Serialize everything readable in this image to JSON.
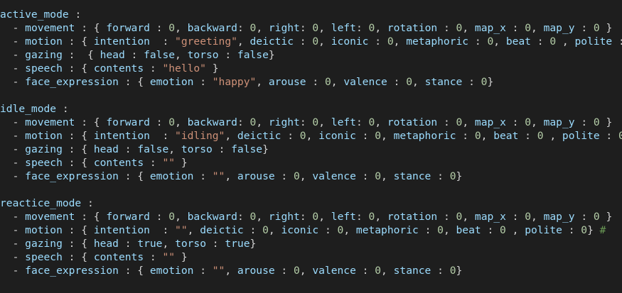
{
  "colors": {
    "background": "#1e1e1e",
    "key": "#9cdcfe",
    "punctuation": "#d4d4d4",
    "number": "#b5cea8",
    "string": "#ce9178",
    "comment": "#6a9955"
  },
  "lines": [
    [
      [
        "k",
        "active_mode"
      ],
      [
        "p",
        " :"
      ]
    ],
    [
      [
        "d",
        "  - "
      ],
      [
        "k",
        "movement"
      ],
      [
        "p",
        " : { "
      ],
      [
        "k",
        "forward"
      ],
      [
        "p",
        " : "
      ],
      [
        "n",
        "0"
      ],
      [
        "p",
        ", "
      ],
      [
        "k",
        "backward"
      ],
      [
        "p",
        ": "
      ],
      [
        "n",
        "0"
      ],
      [
        "p",
        ", "
      ],
      [
        "k",
        "right"
      ],
      [
        "p",
        ": "
      ],
      [
        "n",
        "0"
      ],
      [
        "p",
        ", "
      ],
      [
        "k",
        "left"
      ],
      [
        "p",
        ": "
      ],
      [
        "n",
        "0"
      ],
      [
        "p",
        ", "
      ],
      [
        "k",
        "rotation"
      ],
      [
        "p",
        " : "
      ],
      [
        "n",
        "0"
      ],
      [
        "p",
        ", "
      ],
      [
        "k",
        "map_x"
      ],
      [
        "p",
        " : "
      ],
      [
        "n",
        "0"
      ],
      [
        "p",
        ", "
      ],
      [
        "k",
        "map_y"
      ],
      [
        "p",
        " : "
      ],
      [
        "n",
        "0"
      ],
      [
        "p",
        " }"
      ]
    ],
    [
      [
        "d",
        "  - "
      ],
      [
        "k",
        "motion"
      ],
      [
        "p",
        " : { "
      ],
      [
        "k",
        "intention"
      ],
      [
        "p",
        "  : "
      ],
      [
        "s",
        "\"greeting\""
      ],
      [
        "p",
        ", "
      ],
      [
        "k",
        "deictic"
      ],
      [
        "p",
        " : "
      ],
      [
        "n",
        "0"
      ],
      [
        "p",
        ", "
      ],
      [
        "k",
        "iconic"
      ],
      [
        "p",
        " : "
      ],
      [
        "n",
        "0"
      ],
      [
        "p",
        ", "
      ],
      [
        "k",
        "metaphoric"
      ],
      [
        "p",
        " : "
      ],
      [
        "n",
        "0"
      ],
      [
        "p",
        ", "
      ],
      [
        "k",
        "beat"
      ],
      [
        "p",
        " : "
      ],
      [
        "n",
        "0"
      ],
      [
        "p",
        " , "
      ],
      [
        "k",
        "polite"
      ],
      [
        "p",
        " : "
      ],
      [
        "n",
        "0"
      ],
      [
        "p",
        "} "
      ],
      [
        "c",
        "#"
      ]
    ],
    [
      [
        "d",
        "  - "
      ],
      [
        "k",
        "gazing"
      ],
      [
        "p",
        " :  { "
      ],
      [
        "k",
        "head"
      ],
      [
        "p",
        " : "
      ],
      [
        "k",
        "false"
      ],
      [
        "p",
        ", "
      ],
      [
        "k",
        "torso"
      ],
      [
        "p",
        " : "
      ],
      [
        "k",
        "false"
      ],
      [
        "p",
        "}"
      ]
    ],
    [
      [
        "d",
        "  - "
      ],
      [
        "k",
        "speech"
      ],
      [
        "p",
        " : { "
      ],
      [
        "k",
        "contents"
      ],
      [
        "p",
        " : "
      ],
      [
        "s",
        "\"hello\""
      ],
      [
        "p",
        " }"
      ]
    ],
    [
      [
        "d",
        "  - "
      ],
      [
        "k",
        "face_expression"
      ],
      [
        "p",
        " : { "
      ],
      [
        "k",
        "emotion"
      ],
      [
        "p",
        " : "
      ],
      [
        "s",
        "\"happy\""
      ],
      [
        "p",
        ", "
      ],
      [
        "k",
        "arouse"
      ],
      [
        "p",
        " : "
      ],
      [
        "n",
        "0"
      ],
      [
        "p",
        ", "
      ],
      [
        "k",
        "valence"
      ],
      [
        "p",
        " : "
      ],
      [
        "n",
        "0"
      ],
      [
        "p",
        ", "
      ],
      [
        "k",
        "stance"
      ],
      [
        "p",
        " : "
      ],
      [
        "n",
        "0"
      ],
      [
        "p",
        "}"
      ]
    ],
    [],
    [
      [
        "k",
        "idle_mode"
      ],
      [
        "p",
        " :"
      ]
    ],
    [
      [
        "d",
        "  - "
      ],
      [
        "k",
        "movement"
      ],
      [
        "p",
        " : { "
      ],
      [
        "k",
        "forward"
      ],
      [
        "p",
        " : "
      ],
      [
        "n",
        "0"
      ],
      [
        "p",
        ", "
      ],
      [
        "k",
        "backward"
      ],
      [
        "p",
        ": "
      ],
      [
        "n",
        "0"
      ],
      [
        "p",
        ", "
      ],
      [
        "k",
        "right"
      ],
      [
        "p",
        ": "
      ],
      [
        "n",
        "0"
      ],
      [
        "p",
        ", "
      ],
      [
        "k",
        "left"
      ],
      [
        "p",
        ": "
      ],
      [
        "n",
        "0"
      ],
      [
        "p",
        ", "
      ],
      [
        "k",
        "rotation"
      ],
      [
        "p",
        " : "
      ],
      [
        "n",
        "0"
      ],
      [
        "p",
        ", "
      ],
      [
        "k",
        "map_x"
      ],
      [
        "p",
        " : "
      ],
      [
        "n",
        "0"
      ],
      [
        "p",
        ", "
      ],
      [
        "k",
        "map_y"
      ],
      [
        "p",
        " : "
      ],
      [
        "n",
        "0"
      ],
      [
        "p",
        " }"
      ]
    ],
    [
      [
        "d",
        "  - "
      ],
      [
        "k",
        "motion"
      ],
      [
        "p",
        " : { "
      ],
      [
        "k",
        "intention"
      ],
      [
        "p",
        "  : "
      ],
      [
        "s",
        "\"idling\""
      ],
      [
        "p",
        ", "
      ],
      [
        "k",
        "deictic"
      ],
      [
        "p",
        " : "
      ],
      [
        "n",
        "0"
      ],
      [
        "p",
        ", "
      ],
      [
        "k",
        "iconic"
      ],
      [
        "p",
        " : "
      ],
      [
        "n",
        "0"
      ],
      [
        "p",
        ", "
      ],
      [
        "k",
        "metaphoric"
      ],
      [
        "p",
        " : "
      ],
      [
        "n",
        "0"
      ],
      [
        "p",
        ", "
      ],
      [
        "k",
        "beat"
      ],
      [
        "p",
        " : "
      ],
      [
        "n",
        "0"
      ],
      [
        "p",
        " , "
      ],
      [
        "k",
        "polite"
      ],
      [
        "p",
        " : "
      ],
      [
        "n",
        "0"
      ],
      [
        "p",
        "}"
      ]
    ],
    [
      [
        "d",
        "  - "
      ],
      [
        "k",
        "gazing"
      ],
      [
        "p",
        " : { "
      ],
      [
        "k",
        "head"
      ],
      [
        "p",
        " : "
      ],
      [
        "k",
        "false"
      ],
      [
        "p",
        ", "
      ],
      [
        "k",
        "torso"
      ],
      [
        "p",
        " : "
      ],
      [
        "k",
        "false"
      ],
      [
        "p",
        "}"
      ]
    ],
    [
      [
        "d",
        "  - "
      ],
      [
        "k",
        "speech"
      ],
      [
        "p",
        " : { "
      ],
      [
        "k",
        "contents"
      ],
      [
        "p",
        " : "
      ],
      [
        "s",
        "\"\""
      ],
      [
        "p",
        " }"
      ]
    ],
    [
      [
        "d",
        "  - "
      ],
      [
        "k",
        "face_expression"
      ],
      [
        "p",
        " : { "
      ],
      [
        "k",
        "emotion"
      ],
      [
        "p",
        " : "
      ],
      [
        "s",
        "\"\""
      ],
      [
        "p",
        ", "
      ],
      [
        "k",
        "arouse"
      ],
      [
        "p",
        " : "
      ],
      [
        "n",
        "0"
      ],
      [
        "p",
        ", "
      ],
      [
        "k",
        "valence"
      ],
      [
        "p",
        " : "
      ],
      [
        "n",
        "0"
      ],
      [
        "p",
        ", "
      ],
      [
        "k",
        "stance"
      ],
      [
        "p",
        " : "
      ],
      [
        "n",
        "0"
      ],
      [
        "p",
        "}"
      ]
    ],
    [],
    [
      [
        "k",
        "reactice_mode"
      ],
      [
        "p",
        " :"
      ]
    ],
    [
      [
        "d",
        "  - "
      ],
      [
        "k",
        "movement"
      ],
      [
        "p",
        " : { "
      ],
      [
        "k",
        "forward"
      ],
      [
        "p",
        " : "
      ],
      [
        "n",
        "0"
      ],
      [
        "p",
        ", "
      ],
      [
        "k",
        "backward"
      ],
      [
        "p",
        ": "
      ],
      [
        "n",
        "0"
      ],
      [
        "p",
        ", "
      ],
      [
        "k",
        "right"
      ],
      [
        "p",
        ": "
      ],
      [
        "n",
        "0"
      ],
      [
        "p",
        ", "
      ],
      [
        "k",
        "left"
      ],
      [
        "p",
        ": "
      ],
      [
        "n",
        "0"
      ],
      [
        "p",
        ", "
      ],
      [
        "k",
        "rotation"
      ],
      [
        "p",
        " : "
      ],
      [
        "n",
        "0"
      ],
      [
        "p",
        ", "
      ],
      [
        "k",
        "map_x"
      ],
      [
        "p",
        " : "
      ],
      [
        "n",
        "0"
      ],
      [
        "p",
        ", "
      ],
      [
        "k",
        "map_y"
      ],
      [
        "p",
        " : "
      ],
      [
        "n",
        "0"
      ],
      [
        "p",
        " }"
      ]
    ],
    [
      [
        "d",
        "  - "
      ],
      [
        "k",
        "motion"
      ],
      [
        "p",
        " : { "
      ],
      [
        "k",
        "intention"
      ],
      [
        "p",
        "  : "
      ],
      [
        "s",
        "\"\""
      ],
      [
        "p",
        ", "
      ],
      [
        "k",
        "deictic"
      ],
      [
        "p",
        " : "
      ],
      [
        "n",
        "0"
      ],
      [
        "p",
        ", "
      ],
      [
        "k",
        "iconic"
      ],
      [
        "p",
        " : "
      ],
      [
        "n",
        "0"
      ],
      [
        "p",
        ", "
      ],
      [
        "k",
        "metaphoric"
      ],
      [
        "p",
        " : "
      ],
      [
        "n",
        "0"
      ],
      [
        "p",
        ", "
      ],
      [
        "k",
        "beat"
      ],
      [
        "p",
        " : "
      ],
      [
        "n",
        "0"
      ],
      [
        "p",
        " , "
      ],
      [
        "k",
        "polite"
      ],
      [
        "p",
        " : "
      ],
      [
        "n",
        "0"
      ],
      [
        "p",
        "} "
      ],
      [
        "c",
        "#"
      ]
    ],
    [
      [
        "d",
        "  - "
      ],
      [
        "k",
        "gazing"
      ],
      [
        "p",
        " : { "
      ],
      [
        "k",
        "head"
      ],
      [
        "p",
        " : "
      ],
      [
        "k",
        "true"
      ],
      [
        "p",
        ", "
      ],
      [
        "k",
        "torso"
      ],
      [
        "p",
        " : "
      ],
      [
        "k",
        "true"
      ],
      [
        "p",
        "}"
      ]
    ],
    [
      [
        "d",
        "  - "
      ],
      [
        "k",
        "speech"
      ],
      [
        "p",
        " : { "
      ],
      [
        "k",
        "contents"
      ],
      [
        "p",
        " : "
      ],
      [
        "s",
        "\"\""
      ],
      [
        "p",
        " }"
      ]
    ],
    [
      [
        "d",
        "  - "
      ],
      [
        "k",
        "face_expression"
      ],
      [
        "p",
        " : { "
      ],
      [
        "k",
        "emotion"
      ],
      [
        "p",
        " : "
      ],
      [
        "s",
        "\"\""
      ],
      [
        "p",
        ", "
      ],
      [
        "k",
        "arouse"
      ],
      [
        "p",
        " : "
      ],
      [
        "n",
        "0"
      ],
      [
        "p",
        ", "
      ],
      [
        "k",
        "valence"
      ],
      [
        "p",
        " : "
      ],
      [
        "n",
        "0"
      ],
      [
        "p",
        ", "
      ],
      [
        "k",
        "stance"
      ],
      [
        "p",
        " : "
      ],
      [
        "n",
        "0"
      ],
      [
        "p",
        "}"
      ]
    ]
  ]
}
